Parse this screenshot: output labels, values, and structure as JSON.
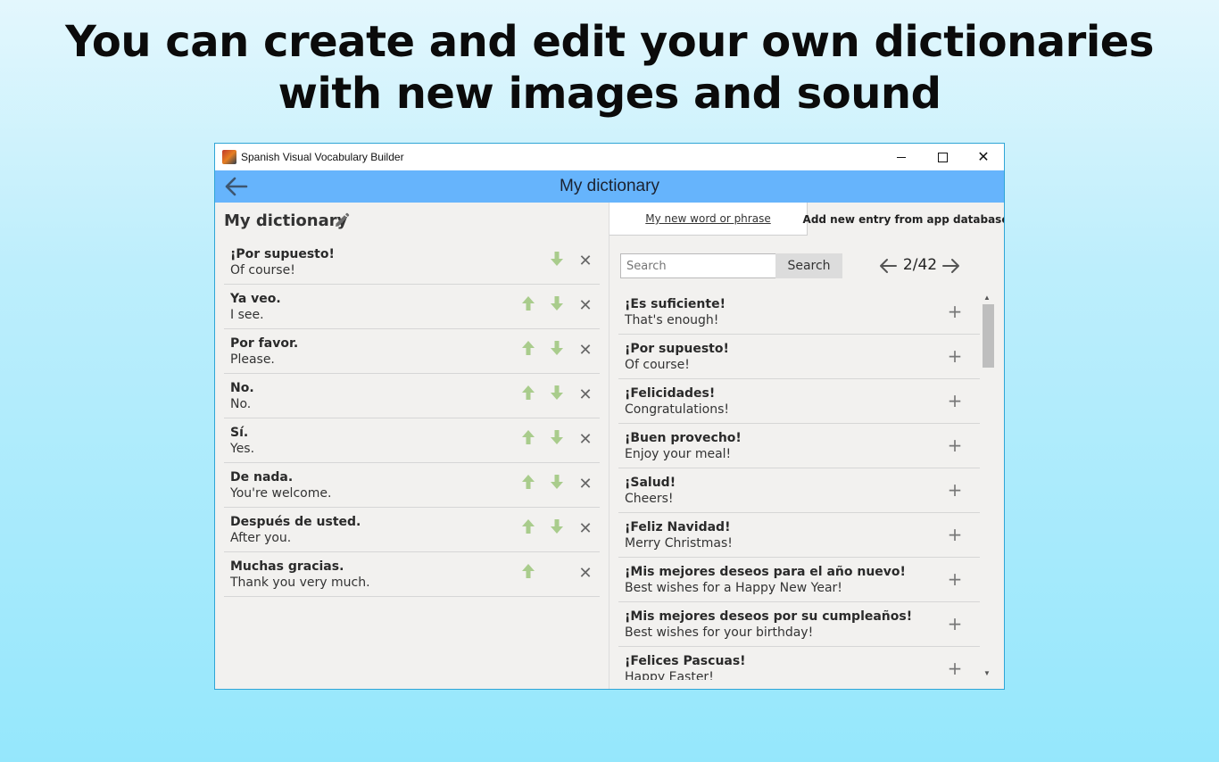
{
  "headline": {
    "line1": "You can create and edit your own dictionaries",
    "line2": "with new images and sound"
  },
  "window": {
    "title": "Spanish Visual Vocabulary Builder",
    "icon": "app-flag-icon",
    "controls": [
      "minimize-icon",
      "maximize-icon",
      "close-icon"
    ]
  },
  "appbar": {
    "title": "My dictionary",
    "back_icon": "arrow-left-icon"
  },
  "left": {
    "title": "My dictionary",
    "edit_icon": "pencil-icon",
    "entries": [
      {
        "es": "¡Por supuesto!",
        "en": "Of course!",
        "up": false,
        "down": true
      },
      {
        "es": "Ya veo.",
        "en": "I see.",
        "up": true,
        "down": true
      },
      {
        "es": "Por favor.",
        "en": "Please.",
        "up": true,
        "down": true
      },
      {
        "es": "No.",
        "en": "No.",
        "up": true,
        "down": true
      },
      {
        "es": "Sí.",
        "en": "Yes.",
        "up": true,
        "down": true
      },
      {
        "es": "De nada.",
        "en": "You're welcome.",
        "up": true,
        "down": true
      },
      {
        "es": "Después de usted.",
        "en": "After you.",
        "up": true,
        "down": true
      },
      {
        "es": "Muchas gracias.",
        "en": "Thank you very much.",
        "up": true,
        "down": false
      }
    ]
  },
  "right": {
    "tabs": {
      "new_entry": "My new word or phrase",
      "from_db": "Add new entry from app database"
    },
    "search": {
      "placeholder": "Search",
      "button": "Search"
    },
    "pagination": {
      "page": "2/42"
    },
    "entries": [
      {
        "es": "¡Es suficiente!",
        "en": "That's enough!"
      },
      {
        "es": "¡Por supuesto!",
        "en": "Of course!"
      },
      {
        "es": "¡Felicidades!",
        "en": "Congratulations!"
      },
      {
        "es": "¡Buen provecho!",
        "en": "Enjoy your meal!"
      },
      {
        "es": "¡Salud!",
        "en": "Cheers!"
      },
      {
        "es": "¡Feliz Navidad!",
        "en": "Merry Christmas!"
      },
      {
        "es": "¡Mis mejores deseos para el año nuevo!",
        "en": "Best wishes for a Happy New Year!"
      },
      {
        "es": "¡Mis mejores deseos por su cumpleaños!",
        "en": "Best wishes for your birthday!"
      },
      {
        "es": "¡Felices Pascuas!",
        "en": "Happy Easter!"
      }
    ]
  },
  "colors": {
    "appbar": "#66b4fc",
    "arrow_green": "#a9cc8c",
    "window_border": "#2fa5d6"
  }
}
